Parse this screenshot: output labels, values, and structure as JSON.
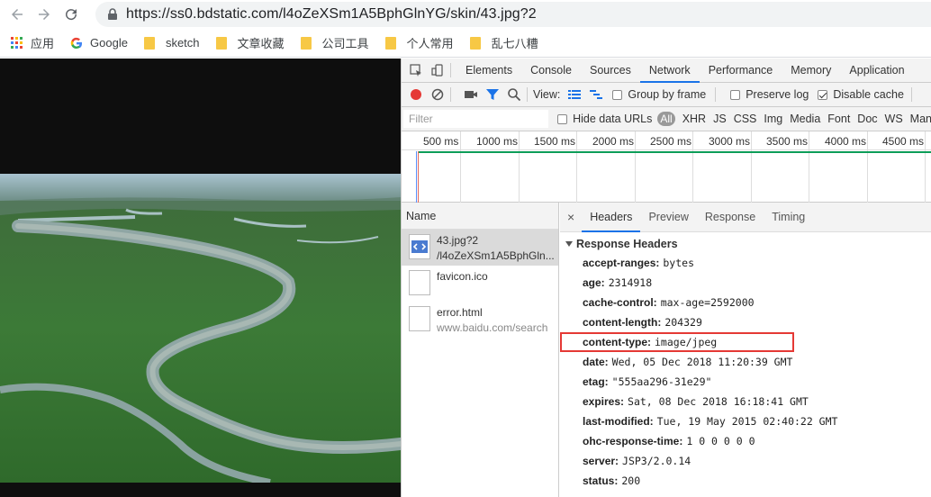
{
  "browser": {
    "url": "https://ss0.bdstatic.com/l4oZeXSm1A5BphGlnYG/skin/43.jpg?2",
    "bookmarks": [
      {
        "label": "应用",
        "icon": "apps-grid-icon"
      },
      {
        "label": "Google",
        "icon": "google-icon"
      },
      {
        "label": "sketch",
        "icon": "folder-icon"
      },
      {
        "label": "文章收藏",
        "icon": "folder-icon"
      },
      {
        "label": "公司工具",
        "icon": "folder-icon"
      },
      {
        "label": "个人常用",
        "icon": "folder-icon"
      },
      {
        "label": "乱七八糟",
        "icon": "folder-icon"
      }
    ]
  },
  "devtools": {
    "tabs": [
      "Elements",
      "Console",
      "Sources",
      "Network",
      "Performance",
      "Memory",
      "Application"
    ],
    "active_tab": "Network",
    "toolbar": {
      "view_label": "View:",
      "group_by_frame": "Group by frame",
      "preserve_log": "Preserve log",
      "disable_cache": "Disable cache",
      "disable_cache_checked": true
    },
    "filter": {
      "placeholder": "Filter",
      "hide_data_urls": "Hide data URLs",
      "types": [
        "All",
        "XHR",
        "JS",
        "CSS",
        "Img",
        "Media",
        "Font",
        "Doc",
        "WS",
        "Man"
      ]
    },
    "timeline_ticks": [
      "500 ms",
      "1000 ms",
      "1500 ms",
      "2000 ms",
      "2500 ms",
      "3000 ms",
      "3500 ms",
      "4000 ms",
      "4500 ms"
    ],
    "requests": {
      "header": "Name",
      "rows": [
        {
          "name": "43.jpg?2",
          "sub": "/l4oZeXSm1A5BphGln...",
          "selected": true
        },
        {
          "name": "favicon.ico",
          "sub": "",
          "selected": false
        },
        {
          "name": "error.html",
          "sub": "www.baidu.com/search",
          "selected": false
        }
      ]
    },
    "detail": {
      "close": "×",
      "tabs": [
        "Headers",
        "Preview",
        "Response",
        "Timing"
      ],
      "active_tab": "Headers",
      "section_title": "Response Headers",
      "headers": [
        {
          "key": "accept-ranges:",
          "value": "bytes"
        },
        {
          "key": "age:",
          "value": "2314918"
        },
        {
          "key": "cache-control:",
          "value": "max-age=2592000"
        },
        {
          "key": "content-length:",
          "value": "204329"
        },
        {
          "key": "content-type:",
          "value": "image/jpeg",
          "highlighted": true
        },
        {
          "key": "date:",
          "value": "Wed, 05 Dec 2018 11:20:39 GMT"
        },
        {
          "key": "etag:",
          "value": "\"555aa296-31e29\""
        },
        {
          "key": "expires:",
          "value": "Sat, 08 Dec 2018 16:18:41 GMT"
        },
        {
          "key": "last-modified:",
          "value": "Tue, 19 May 2015 02:40:22 GMT"
        },
        {
          "key": "ohc-response-time:",
          "value": "1 0 0 0 0 0"
        },
        {
          "key": "server:",
          "value": "JSP3/2.0.14"
        },
        {
          "key": "status:",
          "value": "200"
        }
      ]
    }
  },
  "colors": {
    "accent_blue": "#1a73e8",
    "record_red": "#e53935",
    "highlight_border": "#e53935",
    "timeline_green": "#0d9d58"
  }
}
